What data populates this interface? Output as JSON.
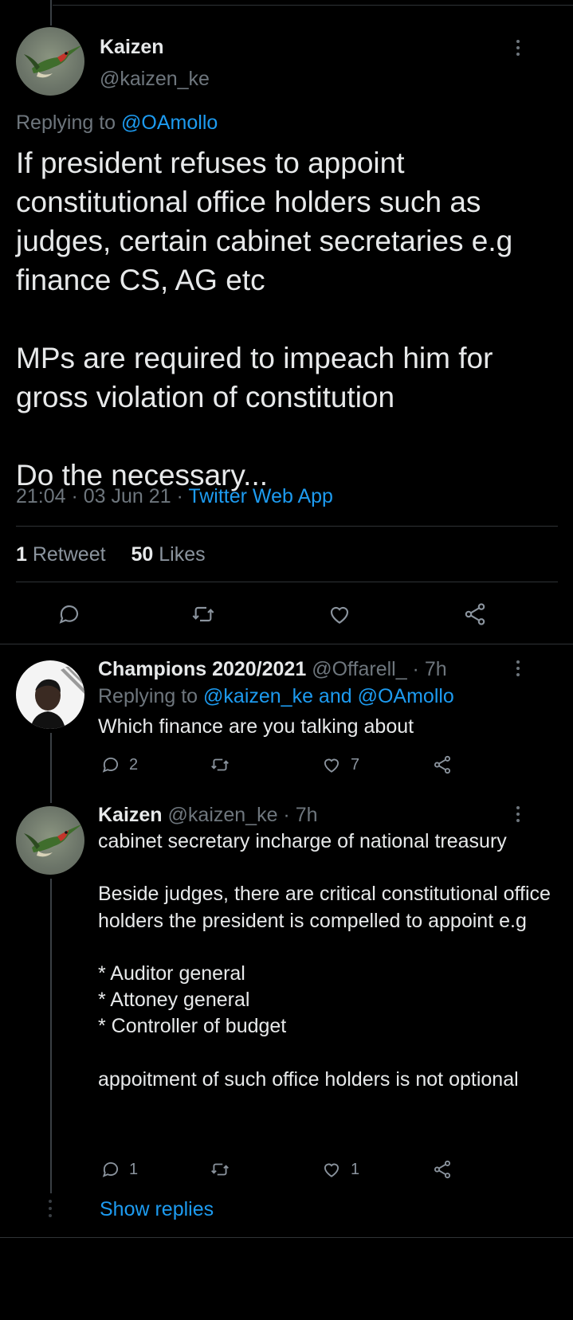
{
  "main_tweet": {
    "author_name": "Kaizen",
    "author_handle": "@kaizen_ke",
    "replying_prefix": "Replying to ",
    "replying_to": "@OAmollo",
    "text": "If president refuses to appoint constitutional office holders such as judges,  certain cabinet secretaries e.g finance CS, AG etc\n\nMPs are required to impeach him for gross violation of constitution\n\nDo the necessary...",
    "timestamp": "21:04 · 03 Jun 21 · ",
    "source": "Twitter Web App",
    "retweet_count": "1",
    "retweet_label": " Retweet",
    "like_count": "50",
    "like_label": " Likes"
  },
  "replies": [
    {
      "author_name": "Champions 2020/2021",
      "author_handle": " @Offarell_ · 7h",
      "replying_prefix": "Replying to ",
      "replying_to": "@kaizen_ke and @OAmollo",
      "text": "Which finance are you talking about",
      "reply_count": "2",
      "like_count": "7"
    },
    {
      "author_name": "Kaizen",
      "author_handle": " @kaizen_ke · 7h",
      "text": "cabinet secretary incharge of national treasury\n\nBeside judges, there are critical constitutional office holders the president is compelled to appoint e.g\n\n* Auditor general\n* Attoney general\n* Controller of budget\n\nappoitment of such office holders is not optional",
      "reply_count": "1",
      "like_count": "1"
    }
  ],
  "show_replies_label": "Show replies",
  "colors": {
    "background": "#000000",
    "text": "#e7e9ea",
    "muted": "#6e767d",
    "link": "#1d9bf0",
    "divider": "#2f3336"
  },
  "icons": [
    "reply-icon",
    "retweet-icon",
    "like-icon",
    "share-icon",
    "more-icon"
  ]
}
